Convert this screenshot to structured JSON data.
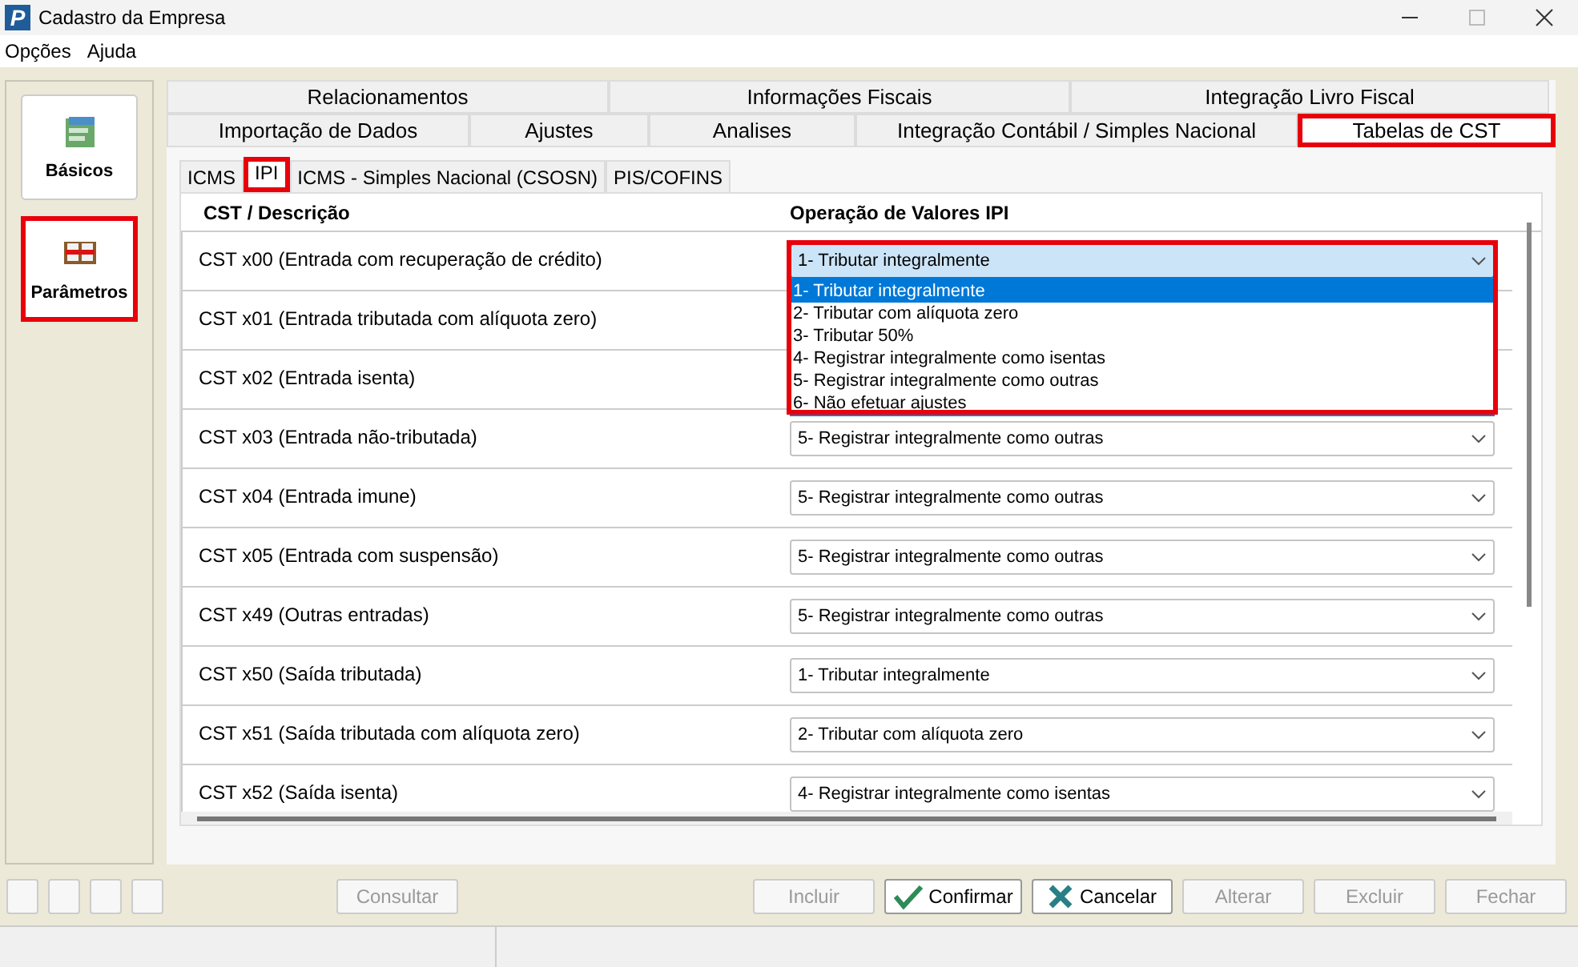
{
  "window": {
    "logo": "P",
    "title": "Cadastro da Empresa"
  },
  "menu": [
    {
      "label": "Opções"
    },
    {
      "label": "Ajuda"
    }
  ],
  "sidebar": {
    "items": [
      {
        "label": "Básicos",
        "kind": "stack",
        "highlighted": false
      },
      {
        "label": "Parâmetros",
        "kind": "book",
        "highlighted": true
      }
    ]
  },
  "tabs": {
    "rows": [
      [
        {
          "label": "Relacionamentos",
          "selected": false,
          "highlighted": false
        },
        {
          "label": "Informações Fiscais",
          "selected": false,
          "highlighted": false
        },
        {
          "label": "Integração Livro Fiscal",
          "selected": false,
          "highlighted": false
        }
      ],
      [
        {
          "label": "Importação de Dados",
          "selected": false,
          "highlighted": false
        },
        {
          "label": "Ajustes",
          "selected": false,
          "highlighted": false
        },
        {
          "label": "Analises",
          "selected": false,
          "highlighted": false
        },
        {
          "label": "Integração Contábil / Simples Nacional",
          "selected": false,
          "highlighted": false
        },
        {
          "label": "Tabelas de CST",
          "selected": true,
          "highlighted": true
        }
      ]
    ]
  },
  "subtabs": [
    {
      "label": "ICMS",
      "selected": false,
      "highlighted": false
    },
    {
      "label": "IPI",
      "selected": true,
      "highlighted": true
    },
    {
      "label": "ICMS - Simples Nacional (CSOSN)",
      "selected": false,
      "highlighted": false
    },
    {
      "label": "PIS/COFINS",
      "selected": false,
      "highlighted": false
    }
  ],
  "table": {
    "columns": [
      "CST / Descrição",
      "Operação de Valores IPI"
    ],
    "rows": [
      {
        "description": "CST x00 (Entrada com recuperação de crédito)",
        "value": "1- Tributar integralmente",
        "expanded": true,
        "highlighted": true,
        "options": [
          {
            "label": "1- Tributar integralmente",
            "selected": true
          },
          {
            "label": "2- Tributar com alíquota zero",
            "selected": false
          },
          {
            "label": "3- Tributar 50%",
            "selected": false
          },
          {
            "label": "4- Registrar integralmente como isentas",
            "selected": false
          },
          {
            "label": "5- Registrar integralmente como outras",
            "selected": false
          },
          {
            "label": "6- Não efetuar ajustes",
            "selected": false
          }
        ]
      },
      {
        "description": "CST x01 (Entrada tributada com alíquota zero)"
      },
      {
        "description": "CST x02 (Entrada isenta)"
      },
      {
        "description": "CST x03 (Entrada não-tributada)",
        "value": "5- Registrar integralmente como outras"
      },
      {
        "description": "CST x04 (Entrada imune)",
        "value": "5- Registrar integralmente como outras"
      },
      {
        "description": "CST x05 (Entrada com suspensão)",
        "value": "5- Registrar integralmente como outras"
      },
      {
        "description": "CST x49 (Outras entradas)",
        "value": "5- Registrar integralmente como outras"
      },
      {
        "description": "CST x50 (Saída tributada)",
        "value": "1- Tributar integralmente"
      },
      {
        "description": "CST x51 (Saída tributada com alíquota zero)",
        "value": "2- Tributar com alíquota zero"
      },
      {
        "description": "CST x52 (Saída isenta)",
        "value": "4- Registrar integralmente como isentas"
      }
    ]
  },
  "buttons": [
    {
      "kind": "blank",
      "disabled": true
    },
    {
      "kind": "blank",
      "disabled": true
    },
    {
      "kind": "blank",
      "disabled": true
    },
    {
      "kind": "blank",
      "disabled": true
    },
    {
      "kind": "spacer-small"
    },
    {
      "label": "Consultar",
      "kind": "text",
      "disabled": true
    },
    {
      "kind": "spacer"
    },
    {
      "label": "Incluir",
      "kind": "text",
      "disabled": true
    },
    {
      "label": "Confirmar",
      "kind": "check",
      "disabled": false
    },
    {
      "label": "Cancelar",
      "kind": "cross",
      "disabled": false
    },
    {
      "label": "Alterar",
      "kind": "text",
      "disabled": true
    },
    {
      "label": "Excluir",
      "kind": "text",
      "disabled": true
    },
    {
      "label": "Fechar",
      "kind": "text",
      "disabled": true
    }
  ]
}
